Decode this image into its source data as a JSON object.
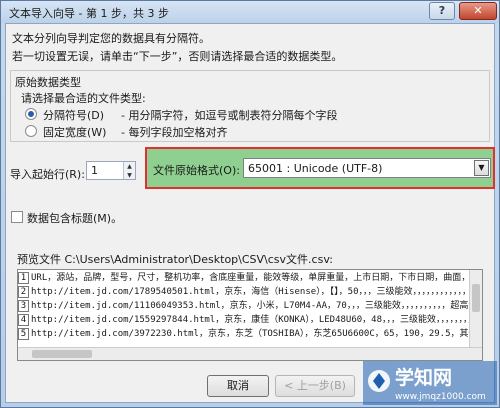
{
  "window": {
    "title": "文本导入向导 - 第 1 步，共 3 步",
    "help_label": "?",
    "close_label": "✕"
  },
  "intro": {
    "line1": "文本分列向导判定您的数据具有分隔符。",
    "line2": "若一切设置无误，请单击“下一步”，否则请选择最合适的数据类型。"
  },
  "original_type": {
    "group_title": "原始数据类型",
    "prompt": "请选择最合适的文件类型:",
    "options": [
      {
        "label": "分隔符号(D)",
        "desc": "- 用分隔字符，如逗号或制表符分隔每个字段",
        "selected": true
      },
      {
        "label": "固定宽度(W)",
        "desc": "- 每列字段加空格对齐",
        "selected": false
      }
    ]
  },
  "import_start": {
    "label": "导入起始行(R):",
    "value": "1"
  },
  "file_origin": {
    "label": "文件原始格式(O):",
    "value": "65001 : Unicode (UTF-8)"
  },
  "has_headers": {
    "label": "数据包含标题(M)。",
    "checked": false
  },
  "preview": {
    "label": "预览文件 C:\\Users\\Administrator\\Desktop\\CSV\\csv文件.csv:",
    "rows": [
      {
        "num": "1",
        "text": "URL，源站，品牌，型号，尺寸，整机功率，含底座重量，能效等级，单屏重量，上市日期，下市日期，曲面，边框颜"
      },
      {
        "num": "2",
        "text": "http://item.jd.com/1789540501.html，京东，海信（Hisense），【】，50，，，三级能效，，，，，，，，，，，，超高"
      },
      {
        "num": "3",
        "text": "http://item.jd.com/11106049353.html，京东，小米，L70M4-AA，70，，，三级能效，，，，，，，，，，超高清4K"
      },
      {
        "num": "4",
        "text": "http://item.jd.com/1559297844.html，京东，康佳（KONKA），LED48U60，48，，，三级能效，，，，，，，，，，"
      },
      {
        "num": "5",
        "text": "http://item.jd.com/3972230.html，京东，东芝（TOSHIBA），东芝65U6600C，65，190，29.5，其他，28.1，20"
      }
    ]
  },
  "buttons": {
    "cancel": "取消",
    "back": "< 上一步(B)"
  },
  "watermark": {
    "brand": "学知网",
    "url": "www.jmqz1000.com"
  }
}
